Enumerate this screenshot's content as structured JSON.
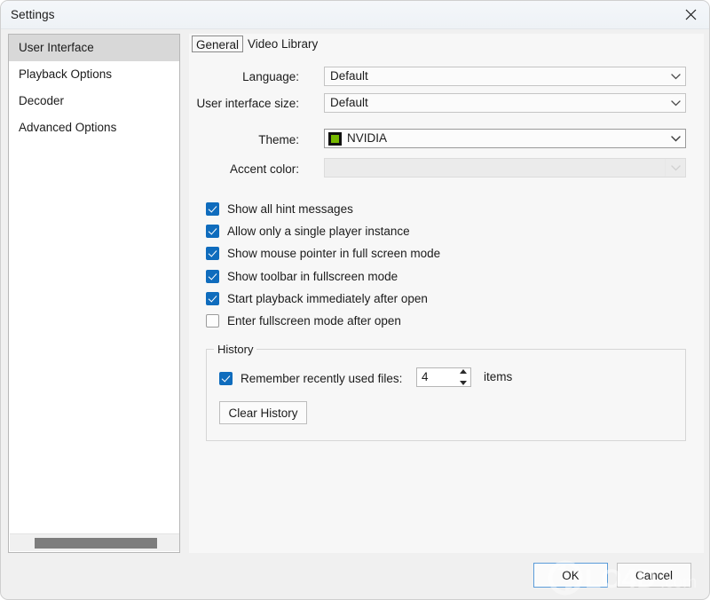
{
  "window": {
    "title": "Settings",
    "close_icon": "close-icon"
  },
  "sidebar": {
    "items": [
      {
        "label": "User Interface",
        "selected": true
      },
      {
        "label": "Playback Options",
        "selected": false
      },
      {
        "label": "Decoder",
        "selected": false
      },
      {
        "label": "Advanced Options",
        "selected": false
      }
    ]
  },
  "tabs": [
    {
      "label": "General",
      "selected": true
    },
    {
      "label": "Video Library",
      "selected": false
    }
  ],
  "form": {
    "language": {
      "label": "Language:",
      "value": "Default",
      "arrow_icon": "chevron-down-icon",
      "enabled": true
    },
    "ui_size": {
      "label": "User interface size:",
      "value": "Default",
      "arrow_icon": "chevron-down-icon",
      "enabled": true
    },
    "theme": {
      "label": "Theme:",
      "value": "NVIDIA",
      "swatch_icon": "nvidia-logo-icon",
      "swatch_color": "#76b900",
      "arrow_icon": "chevron-down-icon",
      "enabled": true
    },
    "accent_color": {
      "label": "Accent color:",
      "value": "",
      "arrow_icon": "chevron-down-icon",
      "enabled": false
    }
  },
  "checkboxes": [
    {
      "label": "Show all hint messages",
      "checked": true
    },
    {
      "label": "Allow only a single player instance",
      "checked": true
    },
    {
      "label": "Show mouse pointer in full screen mode",
      "checked": true
    },
    {
      "label": "Show toolbar in fullscreen mode",
      "checked": true
    },
    {
      "label": "Start playback immediately after open",
      "checked": true
    },
    {
      "label": "Enter fullscreen mode after open",
      "checked": false
    }
  ],
  "history": {
    "legend": "History",
    "remember_label": "Remember recently used files:",
    "remember_checked": true,
    "count_value": "4",
    "items_label": "items",
    "clear_button": "Clear History",
    "spinner_up_icon": "spinner-up-arrow-icon",
    "spinner_down_icon": "spinner-down-arrow-icon"
  },
  "footer": {
    "ok_label": "OK",
    "cancel_label": "Cancel"
  },
  "watermark": {
    "text": "LO4D.com",
    "logo_icon": "circular-arrow-logo-icon"
  },
  "colors": {
    "accent_checkbox": "#0f6cbd",
    "nvidia_green": "#76b900",
    "selection_gray": "#d8d8d8",
    "focus_blue": "#5a9bd8"
  }
}
